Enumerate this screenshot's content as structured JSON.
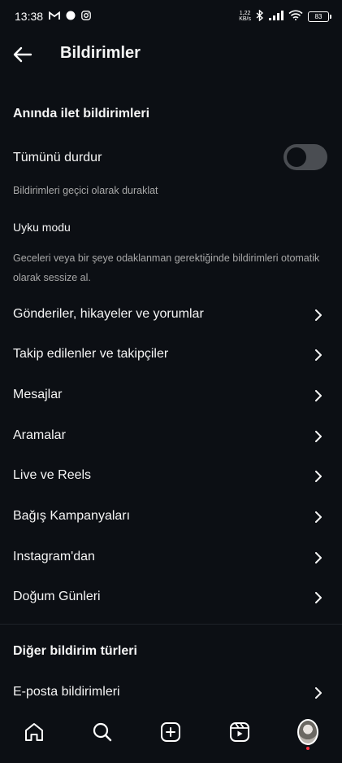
{
  "status_bar": {
    "time": "13:38",
    "net_speed_value": "1,22",
    "net_speed_unit": "KB/s",
    "battery": "83",
    "left_icons": [
      "gmail-icon",
      "circle-icon",
      "instagram-icon"
    ],
    "right_icons": [
      "bluetooth-icon",
      "signal-icon",
      "wifi-icon"
    ]
  },
  "header": {
    "title": "Bildirimler"
  },
  "push_section": {
    "title": "Anında ilet bildirimleri",
    "pause_all": {
      "label": "Tümünü durdur",
      "enabled": false,
      "description": "Bildirimleri geçici olarak duraklat"
    },
    "sleep_mode": {
      "label": "Uyku modu",
      "description": "Geceleri veya bir şeye odaklanman gerektiğinde bildirimleri otomatik olarak sessize al."
    },
    "items": [
      "Gönderiler, hikayeler ve yorumlar",
      "Takip edilenler ve takipçiler",
      "Mesajlar",
      "Aramalar",
      "Live ve Reels",
      "Bağış Kampanyaları",
      "Instagram'dan",
      "Doğum Günleri"
    ]
  },
  "other_section": {
    "title": "Diğer bildirim türleri",
    "items": [
      "E-posta bildirimleri"
    ]
  },
  "bottom_nav": [
    "home-icon",
    "search-icon",
    "create-icon",
    "reels-icon",
    "profile-avatar"
  ],
  "colors": {
    "background": "#0c0f14",
    "text": "#f5f5f5",
    "secondary_text": "#a8a8a8",
    "toggle_off": "#4a4d52",
    "notification_dot": "#ff3040"
  }
}
